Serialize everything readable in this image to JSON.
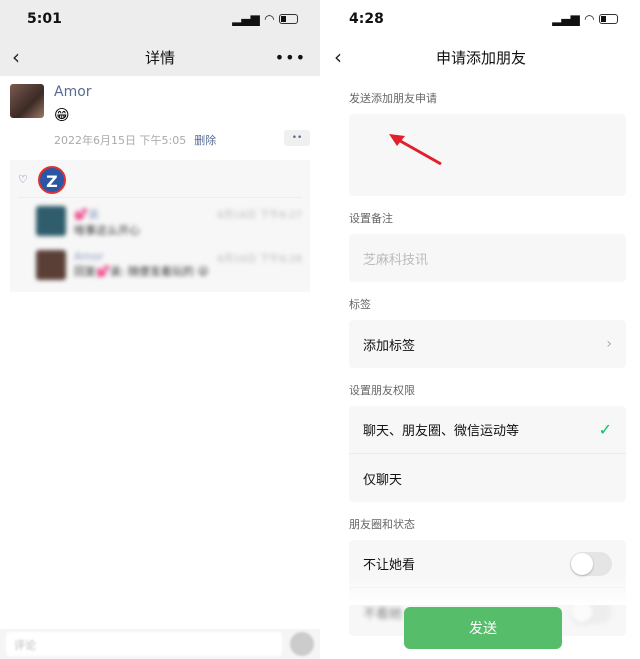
{
  "left": {
    "status": {
      "time": "5:01"
    },
    "nav": {
      "title": "详情",
      "more": "•••"
    },
    "post": {
      "author": "Amor",
      "emoji": "😁",
      "date": "2022年6月15日 下午5:05",
      "delete": "删除",
      "actions": "••"
    },
    "likes": {
      "icon": "heart-icon"
    },
    "comments": [
      {
        "name": "💕诶",
        "time": "6月16日 下午6:27",
        "text": "啥事这么开心"
      },
      {
        "name": "Amor",
        "time": "6月16日 下午6:28",
        "text": "回复💕诶: 随便发着玩的 😜"
      }
    ],
    "comment_bar": {
      "placeholder": "评论"
    }
  },
  "right": {
    "status": {
      "time": "4:28"
    },
    "nav": {
      "title": "申请添加朋友"
    },
    "message": {
      "label": "发送添加朋友申请",
      "value": ""
    },
    "remark": {
      "label": "设置备注",
      "placeholder": "芝麻科技讯"
    },
    "tags": {
      "label": "标签",
      "item": "添加标签"
    },
    "permissions": {
      "label": "设置朋友权限",
      "options": [
        "聊天、朋友圈、微信运动等",
        "仅聊天"
      ],
      "selected": 0
    },
    "moments": {
      "label": "朋友圈和状态",
      "items": [
        {
          "label": "不让她看",
          "on": false
        },
        {
          "label": "不看她",
          "on": false
        }
      ]
    },
    "send": "发送",
    "colors": {
      "accent": "#07c160",
      "button": "#56be6a",
      "link": "#576b95",
      "arrow": "#e0202a"
    }
  }
}
